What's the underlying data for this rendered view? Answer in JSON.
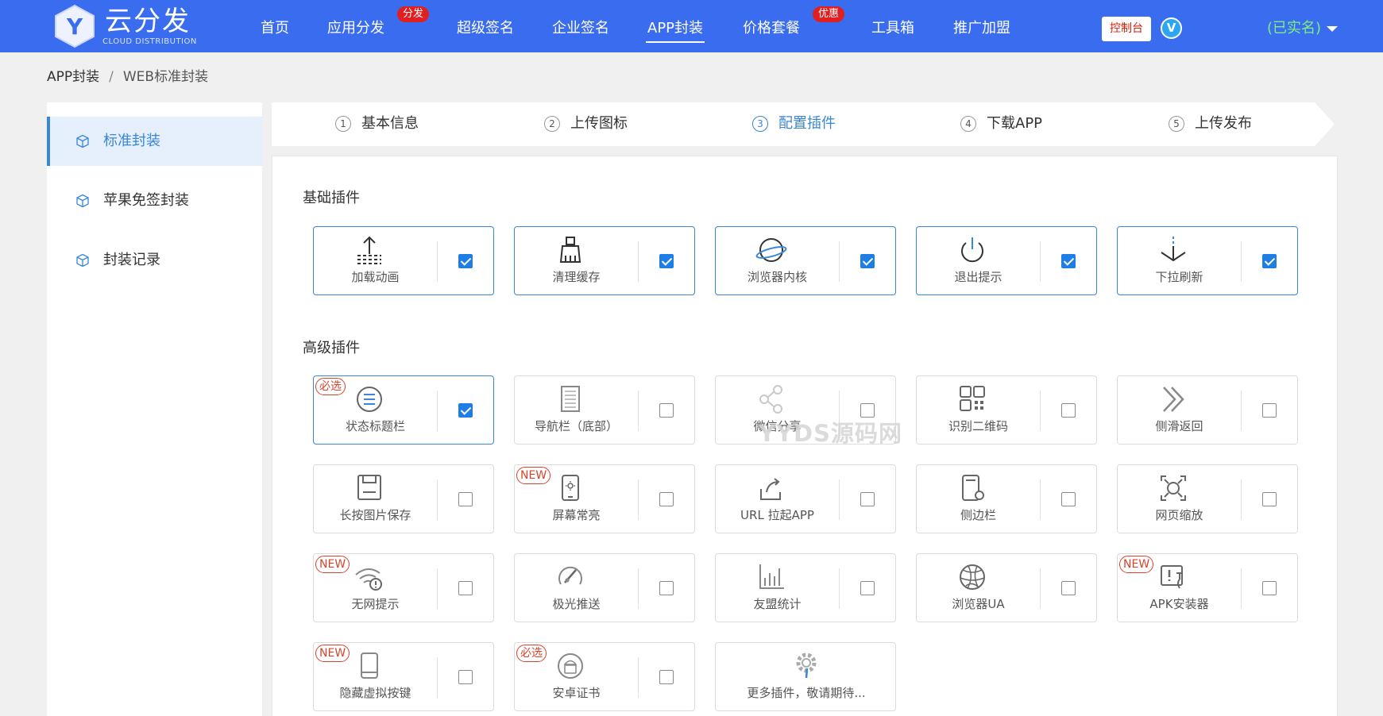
{
  "brand": {
    "name": "云分发",
    "subtitle": "CLOUD DISTRIBUTION",
    "logo_letter": "Y"
  },
  "nav": {
    "items": [
      {
        "label": "首页"
      },
      {
        "label": "应用分发",
        "badge": "分发"
      },
      {
        "label": "超级签名"
      },
      {
        "label": "企业签名"
      },
      {
        "label": "APP封装",
        "active": true
      },
      {
        "label": "价格套餐",
        "badge": "优惠"
      },
      {
        "label": "工具箱"
      },
      {
        "label": "推广加盟"
      }
    ],
    "console": "控制台",
    "v_badge": "V",
    "user_status": "(已实名)"
  },
  "breadcrumb": {
    "root": "APP封装",
    "sep": "/",
    "current": "WEB标准封装"
  },
  "sidebar": {
    "items": [
      {
        "label": "标准封装",
        "active": true
      },
      {
        "label": "苹果免签封装"
      },
      {
        "label": "封装记录"
      }
    ]
  },
  "steps": [
    {
      "num": "1",
      "label": "基本信息"
    },
    {
      "num": "2",
      "label": "上传图标"
    },
    {
      "num": "3",
      "label": "配置插件",
      "active": true
    },
    {
      "num": "4",
      "label": "下载APP"
    },
    {
      "num": "5",
      "label": "上传发布"
    }
  ],
  "sections": {
    "basic": "基础插件",
    "advanced": "高级插件"
  },
  "basic_plugins": [
    {
      "label": "加载动画",
      "icon": "upload-loading-icon",
      "checked": true
    },
    {
      "label": "清理缓存",
      "icon": "broom-icon",
      "checked": true
    },
    {
      "label": "浏览器内核",
      "icon": "planet-icon",
      "checked": true
    },
    {
      "label": "退出提示",
      "icon": "power-icon",
      "checked": true
    },
    {
      "label": "下拉刷新",
      "icon": "pull-down-icon",
      "checked": true
    }
  ],
  "advanced_plugins": [
    {
      "label": "状态标题栏",
      "icon": "status-bar-icon",
      "checked": true,
      "tag": "必选"
    },
    {
      "label": "导航栏（底部）",
      "icon": "nav-bar-icon",
      "checked": false
    },
    {
      "label": "微信分享",
      "icon": "share-icon",
      "checked": false,
      "disabled": true
    },
    {
      "label": "识别二维码",
      "icon": "qrcode-icon",
      "checked": false
    },
    {
      "label": "侧滑返回",
      "icon": "swipe-back-icon",
      "checked": false
    },
    {
      "label": "长按图片保存",
      "icon": "save-icon",
      "checked": false
    },
    {
      "label": "屏幕常亮",
      "icon": "screen-light-icon",
      "checked": false,
      "tag": "NEW"
    },
    {
      "label": "URL 拉起APP",
      "icon": "url-launch-icon",
      "checked": false
    },
    {
      "label": "侧边栏",
      "icon": "sidebar-icon",
      "checked": false
    },
    {
      "label": "网页缩放",
      "icon": "zoom-icon",
      "checked": false
    },
    {
      "label": "无网提示",
      "icon": "no-network-icon",
      "checked": false,
      "tag": "NEW"
    },
    {
      "label": "极光推送",
      "icon": "push-icon",
      "checked": false
    },
    {
      "label": "友盟统计",
      "icon": "stats-icon",
      "checked": false
    },
    {
      "label": "浏览器UA",
      "icon": "globe-icon",
      "checked": false
    },
    {
      "label": "APK安装器",
      "icon": "apk-install-icon",
      "checked": false,
      "tag": "NEW"
    },
    {
      "label": "隐藏虚拟按键",
      "icon": "phone-keys-icon",
      "checked": false,
      "tag": "NEW"
    },
    {
      "label": "安卓证书",
      "icon": "android-cert-icon",
      "checked": false,
      "tag": "必选"
    },
    {
      "label": "更多插件，敬请期待...",
      "icon": "gear-icon",
      "more": true
    }
  ],
  "watermark": "YYDS源码网",
  "colors": {
    "nav_bg": "#3a6cf0",
    "accent": "#3a86d8",
    "checkbox": "#1e7ee6",
    "tag": "#d8432d",
    "user_status": "#7cf07c"
  }
}
